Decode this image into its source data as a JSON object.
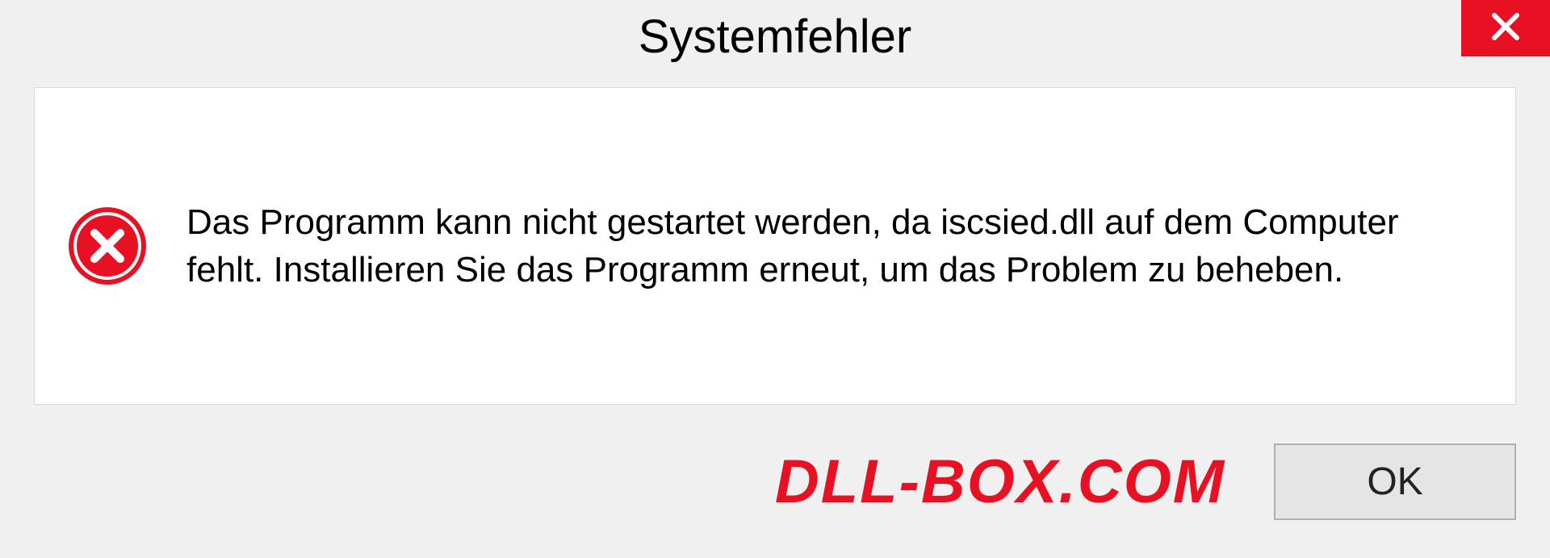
{
  "dialog": {
    "title": "Systemfehler",
    "message": "Das Programm kann nicht gestartet werden, da iscsied.dll auf dem Computer fehlt. Installieren Sie das Programm erneut, um das Problem zu beheben.",
    "ok_label": "OK"
  },
  "watermark": "DLL-BOX.COM",
  "colors": {
    "close_bg": "#e81123",
    "error_icon": "#e81123"
  }
}
